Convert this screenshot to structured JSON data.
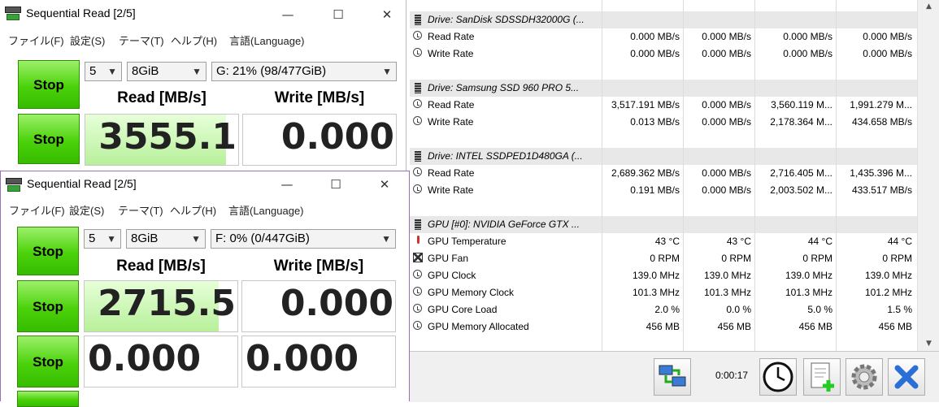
{
  "hwinfo": {
    "rows": [
      {
        "type": "header",
        "label": "Drive: SanDisk SDSSDH32000G (...",
        "v": [
          "",
          "",
          "",
          ""
        ],
        "icon": "drive-icon"
      },
      {
        "type": "data",
        "label": "Read Rate",
        "v": [
          "0.000 MB/s",
          "0.000 MB/s",
          "0.000 MB/s",
          "0.000 MB/s"
        ],
        "icon": "gauge-icon"
      },
      {
        "type": "data",
        "label": "Write Rate",
        "v": [
          "0.000 MB/s",
          "0.000 MB/s",
          "0.000 MB/s",
          "0.000 MB/s"
        ],
        "icon": "gauge-icon"
      },
      {
        "type": "spacer",
        "label": "",
        "v": [
          "",
          "",
          "",
          ""
        ]
      },
      {
        "type": "header",
        "label": "Drive: Samsung SSD 960  PRO 5...",
        "v": [
          "",
          "",
          "",
          ""
        ],
        "icon": "drive-icon"
      },
      {
        "type": "data",
        "label": "Read Rate",
        "v": [
          "3,517.191 MB/s",
          "0.000 MB/s",
          "3,560.119 M...",
          "1,991.279 M..."
        ],
        "icon": "gauge-icon"
      },
      {
        "type": "data",
        "label": "Write Rate",
        "v": [
          "0.013 MB/s",
          "0.000 MB/s",
          "2,178.364 M...",
          "434.658 MB/s"
        ],
        "icon": "gauge-icon"
      },
      {
        "type": "spacer",
        "label": "",
        "v": [
          "",
          "",
          "",
          ""
        ]
      },
      {
        "type": "header",
        "label": "Drive: INTEL SSDPED1D480GA (...",
        "v": [
          "",
          "",
          "",
          ""
        ],
        "icon": "drive-icon"
      },
      {
        "type": "data",
        "label": "Read Rate",
        "v": [
          "2,689.362 MB/s",
          "0.000 MB/s",
          "2,716.405 M...",
          "1,435.396 M..."
        ],
        "icon": "gauge-icon"
      },
      {
        "type": "data",
        "label": "Write Rate",
        "v": [
          "0.191 MB/s",
          "0.000 MB/s",
          "2,003.502 M...",
          "433.517 MB/s"
        ],
        "icon": "gauge-icon"
      },
      {
        "type": "spacer",
        "label": "",
        "v": [
          "",
          "",
          "",
          ""
        ]
      },
      {
        "type": "header",
        "label": "GPU [#0]: NVIDIA GeForce GTX ...",
        "v": [
          "",
          "",
          "",
          ""
        ],
        "icon": "gpu-icon"
      },
      {
        "type": "data",
        "label": "GPU Temperature",
        "v": [
          "43 °C",
          "43 °C",
          "44 °C",
          "44 °C"
        ],
        "icon": "thermometer-icon"
      },
      {
        "type": "data",
        "label": "GPU Fan",
        "v": [
          "0 RPM",
          "0 RPM",
          "0 RPM",
          "0 RPM"
        ],
        "icon": "fan-icon"
      },
      {
        "type": "data",
        "label": "GPU Clock",
        "v": [
          "139.0 MHz",
          "139.0 MHz",
          "139.0 MHz",
          "139.0 MHz"
        ],
        "icon": "gauge-icon"
      },
      {
        "type": "data",
        "label": "GPU Memory Clock",
        "v": [
          "101.3 MHz",
          "101.3 MHz",
          "101.3 MHz",
          "101.2 MHz"
        ],
        "icon": "gauge-icon"
      },
      {
        "type": "data",
        "label": "GPU Core Load",
        "v": [
          "2.0 %",
          "0.0 %",
          "5.0 %",
          "1.5 %"
        ],
        "icon": "gauge-icon"
      },
      {
        "type": "data",
        "label": "GPU Memory Allocated",
        "v": [
          "456 MB",
          "456 MB",
          "456 MB",
          "456 MB"
        ],
        "icon": "gauge-icon"
      }
    ],
    "timer": "0:00:17"
  },
  "cdm_back": {
    "title": "Sequential Read [2/5]",
    "menu": [
      "ファイル(F)",
      "設定(S)",
      "テーマ(T)",
      "ヘルプ(H)",
      "言語(Language)"
    ],
    "count": "5",
    "size": "8GiB",
    "drive": "G: 21% (98/477GiB)",
    "stop_label": "Stop",
    "read_header": "Read [MB/s]",
    "write_header": "Write [MB/s]",
    "read_value": "3555.1",
    "write_value": "0.000",
    "read_progress": 0.92
  },
  "cdm_front": {
    "title": "Sequential Read [2/5]",
    "menu": [
      "ファイル(F)",
      "設定(S)",
      "テーマ(T)",
      "ヘルプ(H)",
      "言語(Language)"
    ],
    "count": "5",
    "size": "8GiB",
    "drive": "F: 0% (0/447GiB)",
    "stop_label": "Stop",
    "read_header": "Read [MB/s]",
    "write_header": "Write [MB/s]",
    "read_value": "2715.5",
    "write_value": "0.000",
    "row2_read": "0.000",
    "row2_write": "0.000",
    "read_progress": 0.88
  },
  "colors": {
    "stop_green": "#4bd20a",
    "header_grey": "#e8e8e8"
  }
}
